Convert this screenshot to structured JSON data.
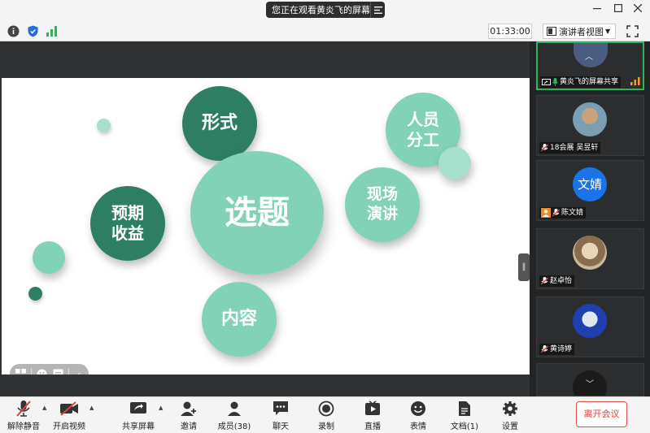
{
  "titlebar": {
    "share_notice": "您正在观看黄炎飞的屏幕"
  },
  "infobar": {
    "timer": "01:33:00",
    "view_mode": "演讲者视图"
  },
  "slide": {
    "bubbles": {
      "topic": "选题",
      "form": "形式",
      "staff": "人员\n分工",
      "presentation": "现场\n演讲",
      "expected": "预期\n收益",
      "content": "内容"
    }
  },
  "gallery": {
    "tiles": [
      {
        "name": "黄炎飞的屏幕共享"
      },
      {
        "name": "18会展 吴昱轩"
      },
      {
        "name": "陈文婧",
        "avatar_text": "文婧"
      },
      {
        "name": "赵卓怡"
      },
      {
        "name": "黄诗婷"
      }
    ]
  },
  "toolbar": {
    "mute": "解除静音",
    "video": "开启视频",
    "share": "共享屏幕",
    "invite": "邀请",
    "members": "成员(38)",
    "chat": "聊天",
    "record": "录制",
    "live": "直播",
    "reaction": "表情",
    "docs": "文档(1)",
    "settings": "设置",
    "leave": "离开会议"
  },
  "colors": {
    "bubble_dark": "#2e7e64",
    "bubble_light": "#82d2b8",
    "accent_green": "#2fb35e",
    "leave_red": "#e03c3c"
  }
}
